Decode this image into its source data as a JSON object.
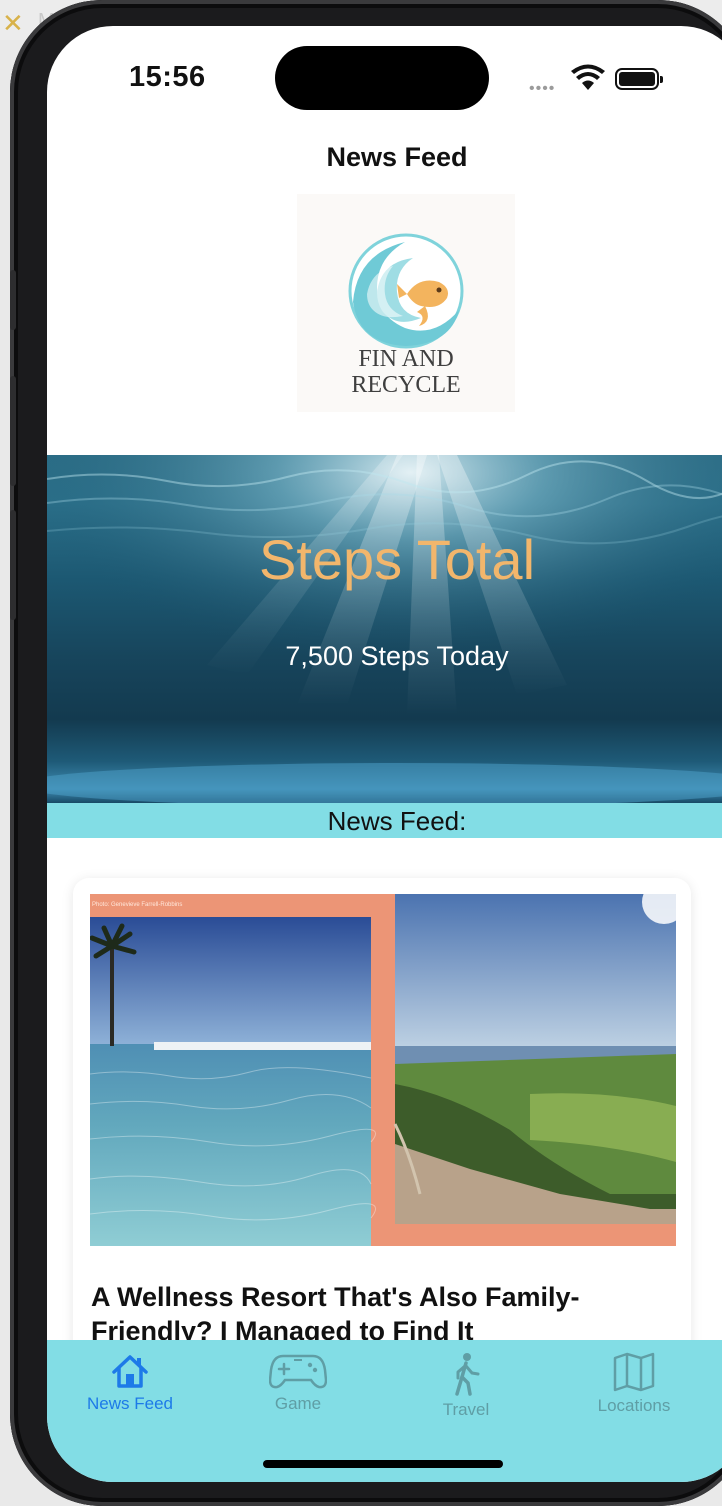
{
  "status_bar": {
    "time": "15:56"
  },
  "nav": {
    "title": "News Feed"
  },
  "logo": {
    "line1": "FIN AND",
    "line2": "RECYCLE"
  },
  "hero": {
    "title": "Steps Total",
    "subtitle": "7,500 Steps Today"
  },
  "section": {
    "label": "News Feed:"
  },
  "article": {
    "caption": "Photo: Genevieve Farrell-Robbins",
    "title": "A Wellness Resort That's Also Family-Friendly? I Managed to Find It"
  },
  "tabs": [
    {
      "label": "News Feed",
      "icon": "house-icon",
      "active": true
    },
    {
      "label": "Game",
      "icon": "gamecontroller-icon",
      "active": false
    },
    {
      "label": "Travel",
      "icon": "figure-walk-icon",
      "active": false
    },
    {
      "label": "Locations",
      "icon": "map-icon",
      "active": false
    }
  ],
  "colors": {
    "tab_bar": "#82dde5",
    "accent": "#1d7ae8",
    "hero_title": "#f2b66c",
    "section_bar": "#82dde5"
  }
}
